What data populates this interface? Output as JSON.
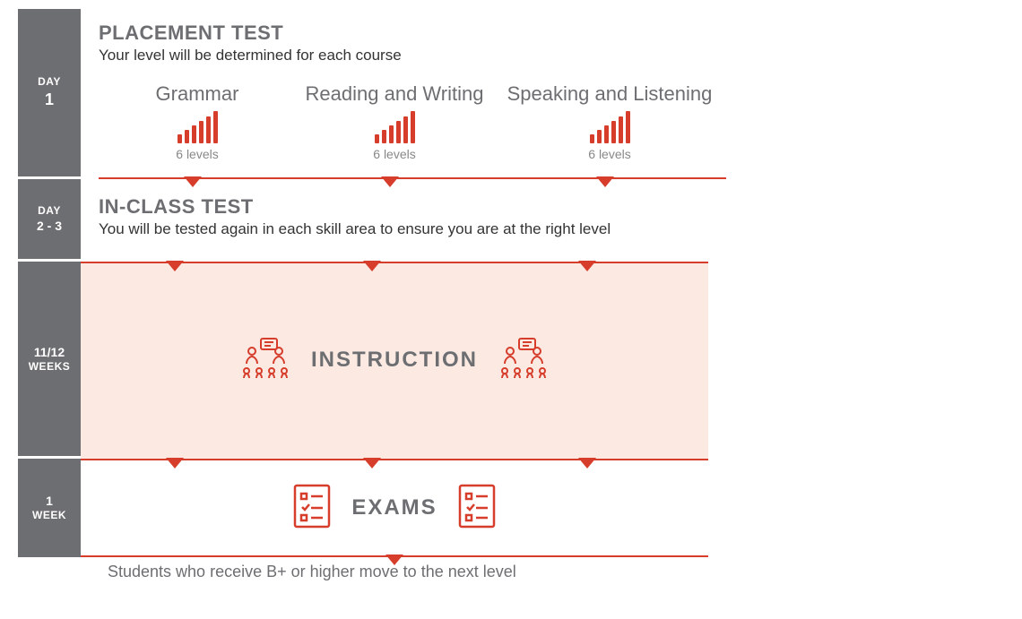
{
  "phase1": {
    "sidebar_line1": "DAY",
    "sidebar_line2": "1",
    "title": "PLACEMENT TEST",
    "subtitle": "Your level will be determined for each course",
    "skills": [
      {
        "name": "Grammar",
        "levels_label": "6 levels"
      },
      {
        "name": "Reading and Writing",
        "levels_label": "6 levels"
      },
      {
        "name": "Speaking and Listening",
        "levels_label": "6 levels"
      }
    ]
  },
  "phase2": {
    "sidebar_line1": "DAY",
    "sidebar_line2": "2 - 3",
    "title": "IN-CLASS TEST",
    "subtitle": "You will be tested again in each skill area to ensure you are at the right level"
  },
  "phase3": {
    "sidebar_line1": "11/12",
    "sidebar_line2": "WEEKS",
    "band_title": "INSTRUCTION"
  },
  "phase4": {
    "sidebar_line1": "1",
    "sidebar_line2": "WEEK",
    "band_title": "EXAMS"
  },
  "footer": "Students who receive B+ or higher move to the next level",
  "colors": {
    "accent": "#d63d2b",
    "sidebar": "#6d6e71",
    "tint": "#fbe9e2"
  }
}
